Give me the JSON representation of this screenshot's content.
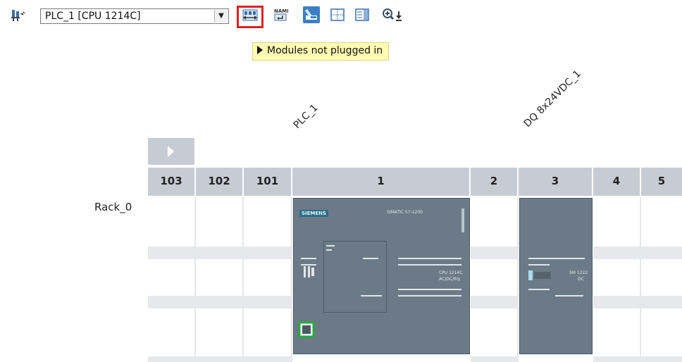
{
  "toolbar": {
    "device_select": "PLC_1 [CPU 1214C]",
    "icons": [
      "network-view-icon",
      "show-unplugged-modules-icon",
      "show-names-icon",
      "module-view-icon",
      "grid-icon",
      "panel-icon",
      "zoom-in-icon"
    ]
  },
  "tooltip": "Modules not plugged in",
  "device_labels": {
    "plc": "PLC_1",
    "dq": "DQ 8x24VDC_1"
  },
  "rack": {
    "name": "Rack_0",
    "slots": [
      "103",
      "102",
      "101",
      "1",
      "2",
      "3",
      "4",
      "5"
    ]
  },
  "modules": {
    "cpu": {
      "brand": "SIEMENS",
      "family": "SIMATIC S7-1200",
      "model": "CPU 1214C",
      "type": "AC/DC/Rly"
    },
    "dq": {
      "family": "SM 1222",
      "type": "DC"
    }
  },
  "colors": {
    "accent": "#e02020",
    "tooltip_bg": "#fffbb3",
    "header_bg": "#c7ccd4",
    "module": "#6b7a86"
  }
}
